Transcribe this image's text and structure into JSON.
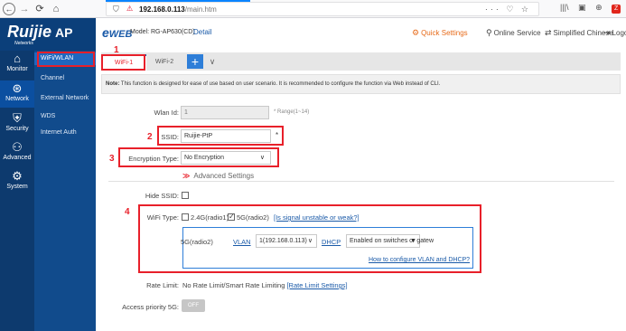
{
  "browser": {
    "url_host": "192.168.0.113",
    "url_path": "/main.htm",
    "nav": {
      "back": "←",
      "forward": "→",
      "reload": "⟳",
      "home": "⌂"
    },
    "url_actions": "··· ♡ ☆",
    "toolbar_icons": [
      "|||\\",
      "▣",
      "⊕"
    ],
    "extension_label": "Z"
  },
  "sidebar": {
    "logo": "Ruijie",
    "logo_ap": "AP",
    "logo_sub": "Networks",
    "rail": [
      {
        "label": "Monitor",
        "icon": "home-icon"
      },
      {
        "label": "Network",
        "icon": "network-icon"
      },
      {
        "label": "Security",
        "icon": "shield-icon"
      },
      {
        "label": "Advanced",
        "icon": "users-icon"
      },
      {
        "label": "System",
        "icon": "gear-icon"
      }
    ],
    "submenu": [
      "WiFi/WLAN",
      "Channel",
      "External Network",
      "WDS",
      "Internet Auth"
    ]
  },
  "header": {
    "brand": "WEB",
    "model": "Model: RG-AP630(CD)",
    "detail": "Detail",
    "quick": "Quick Settings",
    "online": "Online Service",
    "lang": "Simplified Chinese",
    "logout": "Logout"
  },
  "tabs": {
    "wifi1": "WiFi-1",
    "wifi2": "WiFi-2",
    "add": "+",
    "more": "∨"
  },
  "note": {
    "prefix": "Note:",
    "text": " This function is designed for ease of use based on user scenario. It is recommended to configure the function via Web instead of CLI."
  },
  "annotations": [
    "1",
    "2",
    "3",
    "4"
  ],
  "form": {
    "wlan_label": "Wlan Id:",
    "wlan_value": "1",
    "wlan_hint": "* Range(1~14)",
    "ssid_label": "SSID:",
    "ssid_value": "Ruijie-PtP",
    "ssid_star": "*",
    "enc_label": "Encryption Type:",
    "enc_value": "No Encryption",
    "adv_icon": "≫",
    "adv_label": "Advanced Settings",
    "hide_label": "Hide SSID:",
    "wt_label": "WiFi Type:",
    "radio24_label": "2.4G(radio1)",
    "radio5_label": "5G(radio2)",
    "radio5_check": "✓",
    "unstable_link": "[Is signal unstable or weak?]",
    "r5g_label": "5G(radio2)",
    "vlan_link": "VLAN",
    "vlan_value": "1(192.168.0.113)",
    "dhcp_link": "DHCP",
    "dhcp_value": "Enabled on switches or gatew",
    "howto_link": "How to configure VLAN and DHCP?",
    "rate_label": "Rate Limit:",
    "rate_value": "No Rate Limit/Smart Rate Limiting ",
    "rate_link": "[Rate Limit Settings]",
    "ap5_label": "Access priority 5G:",
    "ap5_toggle": "OFF"
  },
  "colors": {
    "accent": "#1a5aa8",
    "annotation_red": "#e8202a",
    "sidebar_dark": "#0b3f7a",
    "quick_orange": "#e76b1a"
  }
}
